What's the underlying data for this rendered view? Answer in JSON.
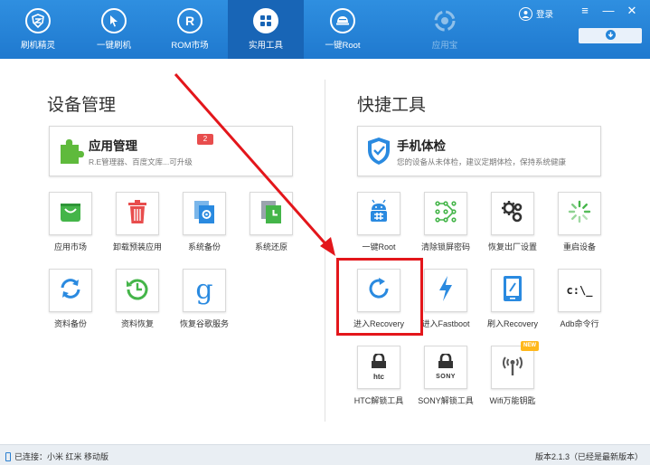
{
  "nav": {
    "items": [
      {
        "label": "刷机精灵",
        "icon": "shield-logo-icon"
      },
      {
        "label": "一键刷机",
        "icon": "cursor-arrow-icon"
      },
      {
        "label": "ROM市场",
        "icon": "r-letter-icon"
      },
      {
        "label": "实用工具",
        "icon": "grid-tools-icon",
        "active": true
      },
      {
        "label": "一键Root",
        "icon": "root-helmet-icon"
      },
      {
        "label": "应用宝",
        "icon": "app-treasure-icon",
        "disabled": true
      }
    ],
    "login_label": "登录",
    "window_buttons": {
      "menu": "≡",
      "minimize": "—",
      "close": "✕"
    },
    "download_icon": "download-arrow-icon"
  },
  "device_section": {
    "title": "设备管理",
    "card": {
      "title": "应用管理",
      "badge": "2",
      "desc": "R.E管理器、百度文库...可升级",
      "icon": "puzzle-icon"
    },
    "tiles": [
      {
        "label": "应用市场",
        "icon": "shopping-bag-icon"
      },
      {
        "label": "卸载预装应用",
        "icon": "trash-icon"
      },
      {
        "label": "系统备份",
        "icon": "system-backup-icon"
      },
      {
        "label": "系统还原",
        "icon": "system-restore-icon"
      },
      {
        "label": "资料备份",
        "icon": "sync-icon"
      },
      {
        "label": "资料恢复",
        "icon": "history-icon"
      },
      {
        "label": "恢复谷歌服务",
        "icon": "google-g-icon"
      }
    ]
  },
  "quick_section": {
    "title": "快捷工具",
    "card": {
      "title": "手机体检",
      "desc": "您的设备从未体检，建议定期体检，保持系统健康",
      "icon": "check-shield-icon"
    },
    "tiles": [
      {
        "label": "一键Root",
        "icon": "android-root-icon"
      },
      {
        "label": "清除锁屏密码",
        "icon": "pattern-lock-icon"
      },
      {
        "label": "恢复出厂设置",
        "icon": "gears-icon"
      },
      {
        "label": "重启设备",
        "icon": "loading-spinner-icon"
      },
      {
        "label": "进入Recovery",
        "icon": "refresh-arrow-icon"
      },
      {
        "label": "进入Fastboot",
        "icon": "lightning-icon"
      },
      {
        "label": "刷入Recovery",
        "icon": "tablet-edit-icon"
      },
      {
        "label": "Adb命令行",
        "icon": "terminal-icon",
        "glyph": "c:\\_"
      },
      {
        "label": "HTC解锁工具",
        "icon": "htc-lock-icon",
        "brand": "htc"
      },
      {
        "label": "SONY解锁工具",
        "icon": "sony-lock-icon",
        "brand": "SONY"
      },
      {
        "label": "Wifi万能钥匙",
        "icon": "wifi-key-icon",
        "badge": "NEW"
      }
    ]
  },
  "status": {
    "connection": "已连接：小米 红米 移动版",
    "version": "版本2.1.3（已经是最新版本）"
  },
  "colors": {
    "nav_bg": "#2585d9",
    "nav_active": "#1865b6",
    "annotation_red": "#e3161b",
    "icon_blue": "#2a8ae0",
    "icon_green": "#44b549",
    "icon_red": "#e84d4d"
  }
}
